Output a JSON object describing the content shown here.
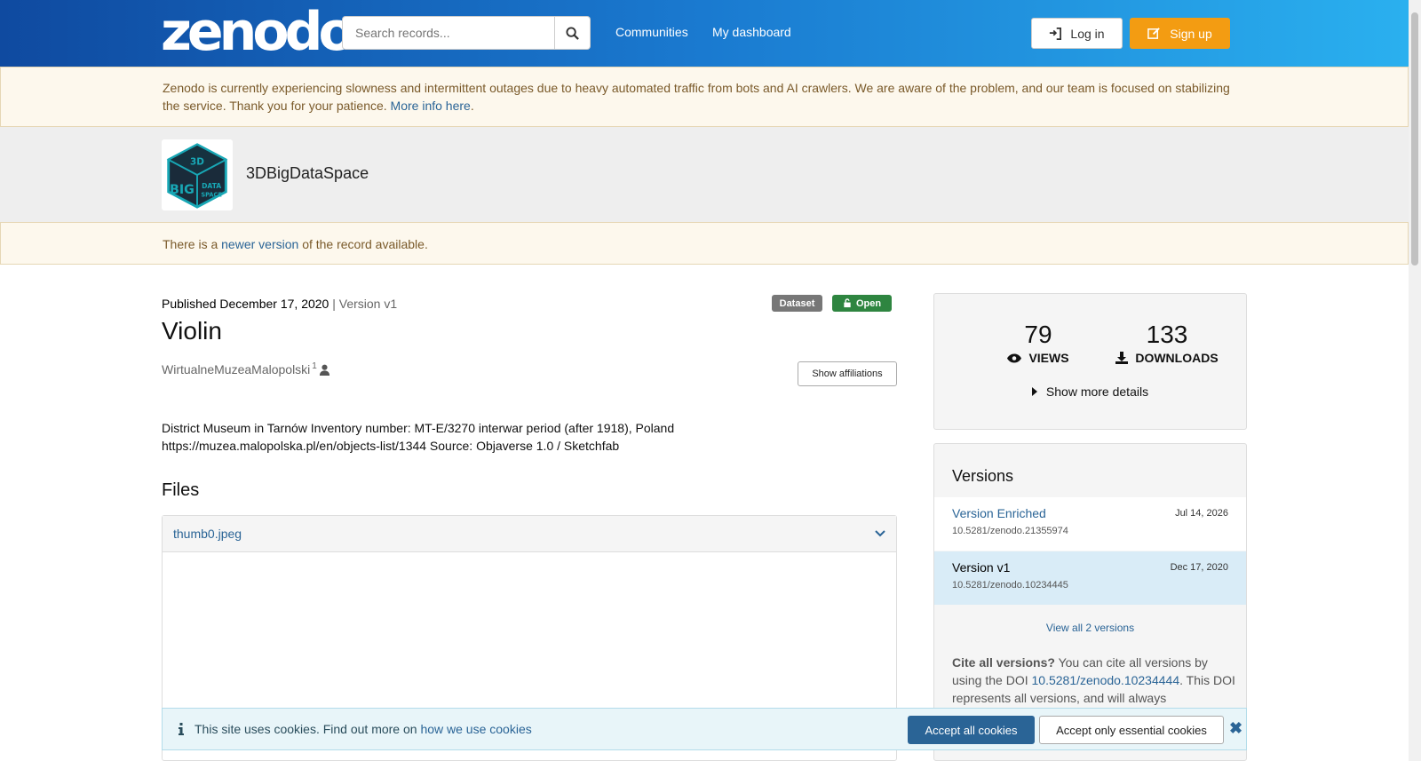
{
  "header": {
    "logo": "zenodo",
    "search_placeholder": "Search records...",
    "nav": [
      "Communities",
      "My dashboard"
    ],
    "login_label": "Log in",
    "signup_label": "Sign up"
  },
  "banner": {
    "text": "Zenodo is currently experiencing slowness and intermittent outages due to heavy automated traffic from bots and AI crawlers. We are aware of the problem, and our team is focused on stabilizing the service. Thank you for your patience.",
    "link": "More info here",
    "end": "."
  },
  "community": {
    "name": "3DBigDataSpace"
  },
  "version_notice": {
    "prefix": "There is a",
    "link": "newer version",
    "suffix": "of the record available."
  },
  "record": {
    "published": "Published December 17, 2020",
    "version": "| Version v1",
    "badge_type": "Dataset",
    "badge_access": "Open",
    "title": "Violin",
    "creator": "WirtualneMuzeaMalopolski",
    "creator_sup": "1",
    "affiliations_label": "Show affiliations",
    "description": "District Museum in Tarnów Inventory number: MT-E/3270 interwar period (after 1918), Poland https://muzea.malopolska.pl/en/objects-list/1344 Source: Objaverse 1.0 / Sketchfab",
    "files_heading": "Files",
    "file_name": "thumb0.jpeg"
  },
  "stats": {
    "views": "79",
    "views_label": "VIEWS",
    "downloads": "133",
    "downloads_label": "DOWNLOADS",
    "more_details": "Show more details"
  },
  "versions": {
    "heading": "Versions",
    "items": [
      {
        "label": "Version Enriched",
        "date": "Jul 14, 2026",
        "doi": "10.5281/zenodo.21355974"
      },
      {
        "label": "Version v1",
        "date": "Dec 17, 2020",
        "doi": "10.5281/zenodo.10234445"
      }
    ],
    "view_all": "View all 2 versions",
    "cite_bold": "Cite all versions?",
    "cite_text": "You can cite all versions by using the DOI",
    "cite_doi": "10.5281/zenodo.10234444",
    "cite_end": ". This DOI represents all versions, and will always"
  },
  "cookies": {
    "text": "This site uses cookies. Find out more on",
    "link": "how we use cookies",
    "accept_all": "Accept all cookies",
    "accept_essential": "Accept only essential cookies"
  },
  "colors": {
    "accent": "#2a6496",
    "signup": "#f39c12",
    "open": "#2e8540"
  }
}
